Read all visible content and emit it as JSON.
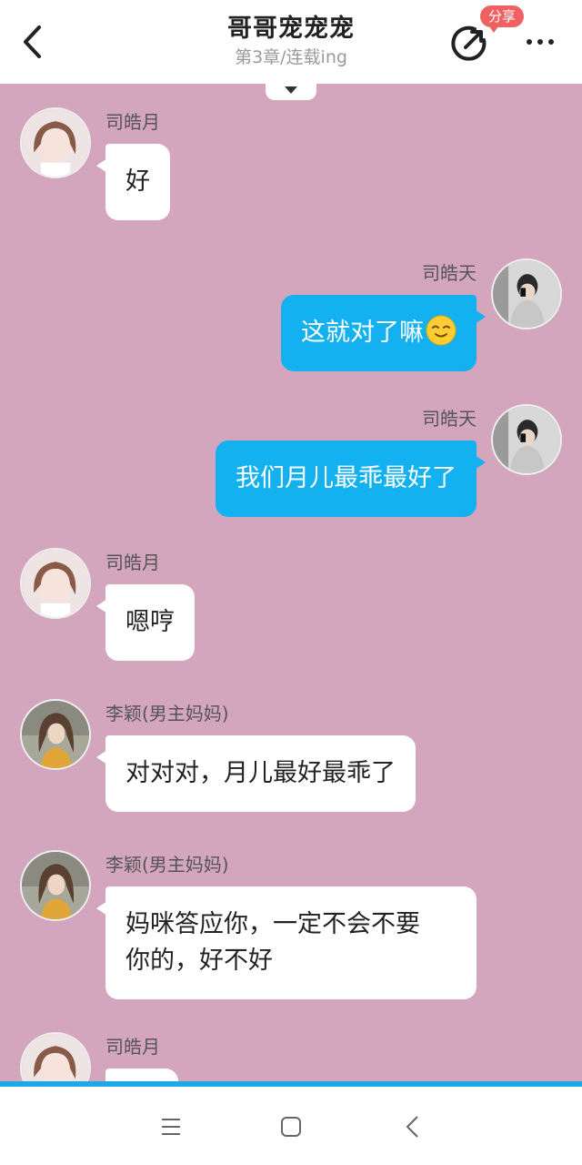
{
  "header": {
    "title": "哥哥宠宠宠",
    "subtitle": "第3章/连载ing",
    "share_badge": "分享"
  },
  "icons": {
    "back": "chevron-left-icon",
    "share": "share-icon",
    "more": "more-dots-icon",
    "expand": "triangle-down-icon"
  },
  "colors": {
    "background": "#d3a6bd",
    "right_bubble": "#13b1ef",
    "badge": "#f06262",
    "progress": "#1ea8e6"
  },
  "messages": [
    {
      "side": "left",
      "name": "司皓月",
      "text": "好"
    },
    {
      "side": "right",
      "name": "司皓天",
      "text": "这就对了嘛",
      "emoji": "relieved-face"
    },
    {
      "side": "right",
      "name": "司皓天",
      "text": "我们月儿最乖最好了"
    },
    {
      "side": "left",
      "name": "司皓月",
      "text": "嗯哼"
    },
    {
      "side": "left",
      "name": "李颖(男主妈妈)",
      "text": "对对对，月儿最好最乖了"
    },
    {
      "side": "left",
      "name": "李颖(男主妈妈)",
      "text": "妈咪答应你，一定不会不要\n你的，好不好"
    },
    {
      "side": "left",
      "name": "司皓月",
      "text": ""
    }
  ],
  "system_nav": {
    "menu": "menu-icon",
    "home": "home-square-icon",
    "back": "back-triangle-icon"
  }
}
